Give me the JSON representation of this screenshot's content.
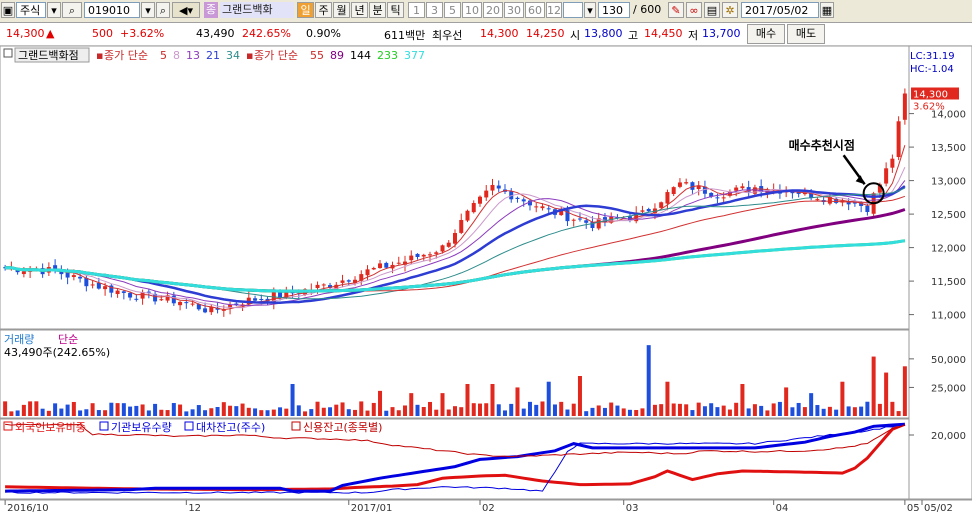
{
  "toolbar": {
    "market": "주식",
    "code": "019010",
    "badge_jong": "종",
    "stock_name": "그랜드백화",
    "period_selected": "일",
    "periods": [
      "주",
      "월",
      "년",
      "분",
      "틱"
    ],
    "minute_options": [
      "1",
      "3",
      "5",
      "10",
      "20",
      "30",
      "60",
      "120"
    ],
    "count": "130",
    "total": "/ 600",
    "date": "2017/05/02"
  },
  "info": {
    "price": "14,300",
    "change_arrow": "▲",
    "change": "500",
    "change_pct": "+3.62%",
    "volume": "43,490",
    "volume_ratio": "242.65%",
    "turnover": "0.90%",
    "amount": "611백만",
    "best_label": "최우선",
    "ask": "14,300",
    "bid": "14,250",
    "open_label": "시",
    "open": "13,800",
    "high_label": "고",
    "high": "14,450",
    "low_label": "저",
    "low": "13,700",
    "buy_button": "매수",
    "sell_button": "매도"
  },
  "colors": {
    "up": "#e0281e",
    "down": "#1e4fdc",
    "ma5": "#d23232",
    "ma8": "#8c3cbe",
    "ma13": "#2d3cd2",
    "ma21": "#2d8c8c",
    "ma34": "#0000c0",
    "vma55": "#2ecc2e",
    "vma89": "#800080",
    "vma144": "#444444",
    "vma233": "#22cc22",
    "vma377": "#33dddd",
    "foreign": "#e01010",
    "institution": "#0000e0",
    "loan": "#0000e0",
    "credit": "#c00000"
  },
  "chart_data": [
    {
      "type": "candlestick",
      "title": "그랜드백화점",
      "legend": [
        {
          "label": "종가 단순",
          "color": "#c82828"
        },
        {
          "label": "5",
          "color": "#c82828"
        },
        {
          "label": "8",
          "color": "#cc99cc"
        },
        {
          "label": "13",
          "color": "#8c3cbe"
        },
        {
          "label": "21",
          "color": "#2d3cd2"
        },
        {
          "label": "34",
          "color": "#2d8c8c"
        },
        {
          "label": "종가 단순",
          "color": "#c82828"
        },
        {
          "label": "55",
          "color": "#c82828"
        },
        {
          "label": "89",
          "color": "#800080"
        },
        {
          "label": "144",
          "color": "#000000"
        },
        {
          "label": "233",
          "color": "#22cc22"
        },
        {
          "label": "377",
          "color": "#33dddd"
        }
      ],
      "indicators": {
        "lc": "LC:31.19",
        "hc": "HC:-1.04"
      },
      "current_price": "14,300",
      "current_pct": "3.62%",
      "annotation": "매수추천시점",
      "ylim": [
        10800,
        14800
      ],
      "yticks": [
        {
          "v": 14000,
          "label": "14,000"
        },
        {
          "v": 13500,
          "label": "13,500"
        },
        {
          "v": 13000,
          "label": "13,000"
        },
        {
          "v": 12500,
          "label": "12,500"
        },
        {
          "v": 12000,
          "label": "12,000"
        },
        {
          "v": 11500,
          "label": "11,500"
        },
        {
          "v": 11000,
          "label": "11,000"
        }
      ],
      "price_anchors": [
        [
          0,
          11700
        ],
        [
          8,
          11650
        ],
        [
          14,
          11450
        ],
        [
          20,
          11300
        ],
        [
          28,
          11200
        ],
        [
          33,
          11050
        ],
        [
          38,
          11200
        ],
        [
          45,
          11300
        ],
        [
          52,
          11450
        ],
        [
          58,
          11650
        ],
        [
          64,
          11800
        ],
        [
          70,
          12000
        ],
        [
          74,
          12500
        ],
        [
          78,
          12900
        ],
        [
          82,
          12750
        ],
        [
          87,
          12550
        ],
        [
          94,
          12350
        ],
        [
          102,
          12500
        ],
        [
          108,
          12950
        ],
        [
          114,
          12800
        ],
        [
          120,
          12900
        ],
        [
          126,
          12850
        ],
        [
          131,
          12750
        ],
        [
          135,
          12700
        ],
        [
          138,
          12600
        ],
        [
          140,
          12950
        ],
        [
          142,
          13350
        ],
        [
          144,
          14300
        ]
      ],
      "annotated_index": 139
    },
    {
      "type": "bar",
      "title": "거래량",
      "legend": [
        {
          "label": "거래량",
          "color": "#1e4fdc"
        },
        {
          "label": "단순",
          "color": "#c0008c"
        }
      ],
      "readout": "43,490주(242.65%)",
      "ylim": [
        0,
        70000
      ],
      "yticks": [
        {
          "v": 50000,
          "label": "50,000"
        },
        {
          "v": 25000,
          "label": "25,000"
        }
      ],
      "spikes": {
        "46": 28000,
        "60": 22000,
        "65": 20000,
        "70": 20000,
        "74": 28000,
        "78": 28000,
        "82": 25000,
        "87": 30000,
        "92": 35000,
        "103": 62000,
        "106": 30000,
        "118": 28000,
        "125": 25000,
        "129": 20000,
        "134": 30000,
        "139": 52000,
        "141": 38000,
        "144": 43490
      }
    },
    {
      "type": "line",
      "legend": [
        {
          "label": "외국인보유비중",
          "color": "#e01010"
        },
        {
          "label": "기관보유수량",
          "color": "#0000e0"
        },
        {
          "label": "대차잔고(주수)",
          "color": "#0000e0"
        },
        {
          "label": "신용잔고(종목별)",
          "color": "#c00000"
        }
      ],
      "ytick": "20,000",
      "series": [
        {
          "name": "외국인보유비중",
          "anchors": [
            [
              0,
              0.1
            ],
            [
              22,
              0.07
            ],
            [
              40,
              0.06
            ],
            [
              52,
              0.07
            ],
            [
              56,
              0.09
            ],
            [
              62,
              0.11
            ],
            [
              66,
              0.13
            ],
            [
              70,
              0.22
            ],
            [
              76,
              0.25
            ],
            [
              80,
              0.26
            ],
            [
              86,
              0.18
            ],
            [
              92,
              0.13
            ],
            [
              100,
              0.14
            ],
            [
              104,
              0.24
            ],
            [
              106,
              0.32
            ],
            [
              110,
              0.2
            ],
            [
              114,
              0.28
            ],
            [
              118,
              0.32
            ],
            [
              124,
              0.31
            ],
            [
              130,
              0.3
            ],
            [
              134,
              0.29
            ],
            [
              136,
              0.36
            ],
            [
              138,
              0.5
            ],
            [
              140,
              0.7
            ],
            [
              142,
              0.9
            ],
            [
              144,
              0.97
            ]
          ]
        },
        {
          "name": "기관보유수량",
          "anchors": [
            [
              0,
              0.04
            ],
            [
              20,
              0.06
            ],
            [
              24,
              0.08
            ],
            [
              44,
              0.08
            ],
            [
              46,
              0.04
            ],
            [
              52,
              0.04
            ],
            [
              54,
              0.12
            ],
            [
              60,
              0.22
            ],
            [
              66,
              0.3
            ],
            [
              72,
              0.38
            ],
            [
              76,
              0.48
            ],
            [
              82,
              0.52
            ],
            [
              88,
              0.6
            ],
            [
              91,
              0.7
            ],
            [
              94,
              0.64
            ],
            [
              100,
              0.64
            ],
            [
              120,
              0.64
            ],
            [
              128,
              0.72
            ],
            [
              132,
              0.8
            ],
            [
              136,
              0.86
            ],
            [
              139,
              0.94
            ],
            [
              144,
              0.97
            ]
          ]
        },
        {
          "name": "대차잔고(주수)",
          "anchors": [
            [
              0,
              0.02
            ],
            [
              40,
              0.02
            ],
            [
              50,
              0.02
            ],
            [
              58,
              0.02
            ],
            [
              62,
              0.06
            ],
            [
              70,
              0.1
            ],
            [
              80,
              0.08
            ],
            [
              86,
              0.04
            ],
            [
              88,
              0.3
            ],
            [
              90,
              0.6
            ],
            [
              92,
              0.7
            ],
            [
              120,
              0.7
            ],
            [
              130,
              0.8
            ],
            [
              138,
              0.88
            ],
            [
              144,
              0.97
            ]
          ]
        },
        {
          "name": "신용잔고(종목별)",
          "anchors": [
            [
              0,
              0.96
            ],
            [
              12,
              0.96
            ],
            [
              14,
              0.83
            ],
            [
              22,
              0.82
            ],
            [
              28,
              0.8
            ],
            [
              38,
              0.82
            ],
            [
              44,
              0.78
            ],
            [
              54,
              0.76
            ],
            [
              58,
              0.74
            ],
            [
              62,
              0.68
            ],
            [
              68,
              0.62
            ],
            [
              72,
              0.58
            ],
            [
              76,
              0.54
            ],
            [
              82,
              0.52
            ],
            [
              90,
              0.55
            ],
            [
              100,
              0.58
            ],
            [
              108,
              0.56
            ],
            [
              112,
              0.6
            ],
            [
              120,
              0.59
            ],
            [
              128,
              0.6
            ],
            [
              134,
              0.64
            ],
            [
              138,
              0.7
            ],
            [
              142,
              0.9
            ],
            [
              144,
              0.96
            ]
          ]
        }
      ]
    }
  ],
  "xaxis": {
    "labels": [
      {
        "i": 0,
        "label": "2016/10"
      },
      {
        "i": 29,
        "label": "12"
      },
      {
        "i": 55,
        "label": "2017/01"
      },
      {
        "i": 76,
        "label": "02"
      },
      {
        "i": 99,
        "label": "03"
      },
      {
        "i": 123,
        "label": "04"
      },
      {
        "i": 144,
        "label": "05"
      },
      {
        "i": 151,
        "label": "05/02"
      }
    ]
  }
}
